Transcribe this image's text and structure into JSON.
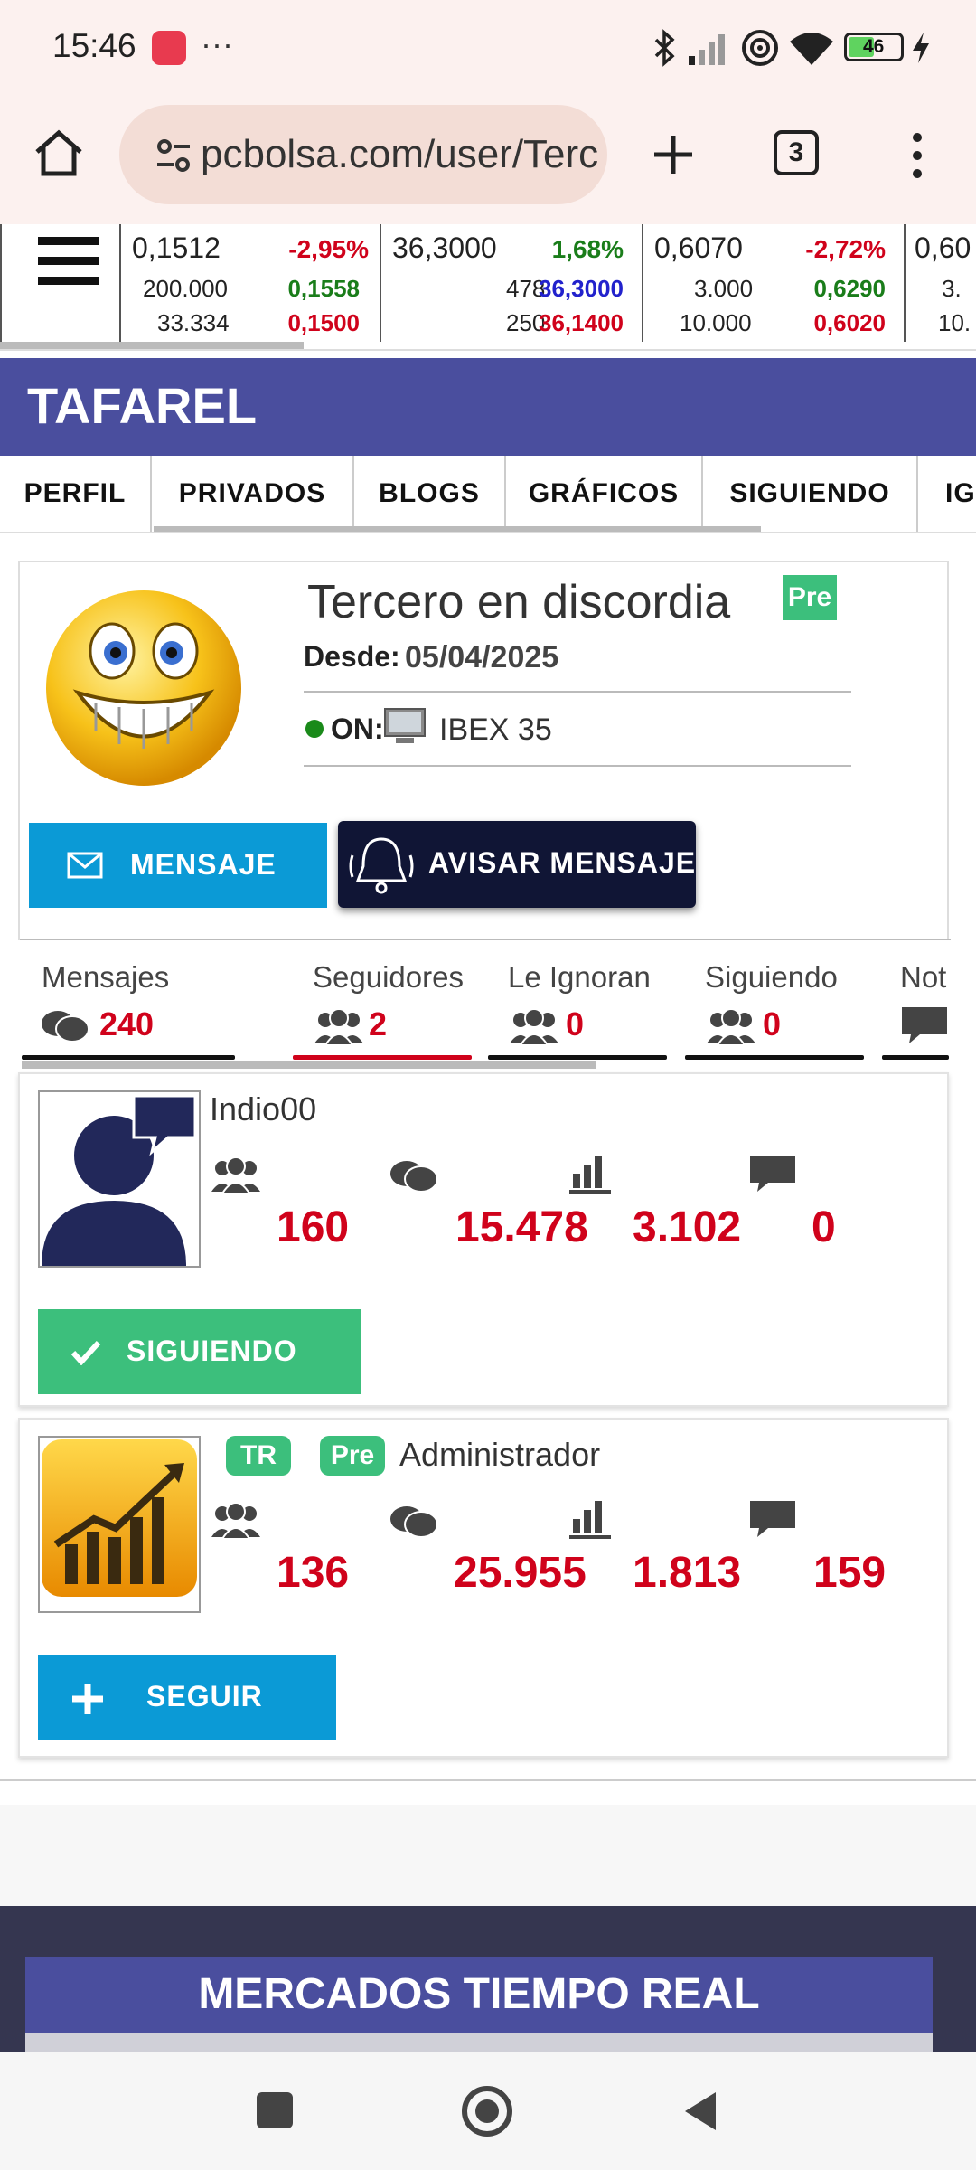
{
  "status_bar": {
    "time": "15:46",
    "dots": "···",
    "battery": "46"
  },
  "browser": {
    "url": "pcbolsa.com/user/Tercero",
    "tabs_count": "3"
  },
  "ticker": [
    {
      "row1": [
        "0,1512",
        "-2,95%"
      ],
      "row2": [
        "200.000",
        "0,1558"
      ],
      "row3": [
        "33.334",
        "0,1500"
      ]
    },
    {
      "row1": [
        "36,3000",
        "1,68%"
      ],
      "row2": [
        "478",
        "36,3000"
      ],
      "row3": [
        "250",
        "36,1400"
      ]
    },
    {
      "row1": [
        "0,6070",
        "-2,72%"
      ],
      "row2": [
        "3.000",
        "0,6290"
      ],
      "row3": [
        "10.000",
        "0,6020"
      ]
    },
    {
      "row1": [
        "0,60",
        ""
      ],
      "row2": [
        "3.",
        ""
      ],
      "row3": [
        "10.",
        ""
      ]
    }
  ],
  "header": {
    "brand": "TAFAREL"
  },
  "tabs": [
    "PERFIL",
    "PRIVADOS",
    "BLOGS",
    "GRÁFICOS",
    "SIGUIENDO",
    "IG"
  ],
  "profile": {
    "name": "Tercero en discordia",
    "badge": "Pre",
    "since_label": "Desde:",
    "since_date": "05/04/2025",
    "online_label": "ON:",
    "market": "IBEX 35",
    "message_button": "MENSAJE",
    "notify_button": "AVISAR MENSAJE"
  },
  "stats": [
    {
      "label": "Mensajes",
      "value": "240"
    },
    {
      "label": "Seguidores",
      "value": "2"
    },
    {
      "label": "Le Ignoran",
      "value": "0"
    },
    {
      "label": "Siguiendo",
      "value": "0"
    },
    {
      "label": "Not",
      "value": ""
    }
  ],
  "users": [
    {
      "name": "Indio00",
      "badges": [],
      "followers": "160",
      "messages": "15.478",
      "charts": "3.102",
      "comments": "0",
      "button": "SIGUIENDO"
    },
    {
      "name": "Administrador",
      "badges": [
        "TR",
        "Pre"
      ],
      "followers": "136",
      "messages": "25.955",
      "charts": "1.813",
      "comments": "159",
      "button": "SEGUIR"
    }
  ],
  "footer": {
    "title": "MERCADOS TIEMPO REAL"
  },
  "colors": {
    "brand": "#4a4e9e",
    "red": "#d0021b",
    "green": "#3cbf7c",
    "blue": "#0b9ad6"
  }
}
